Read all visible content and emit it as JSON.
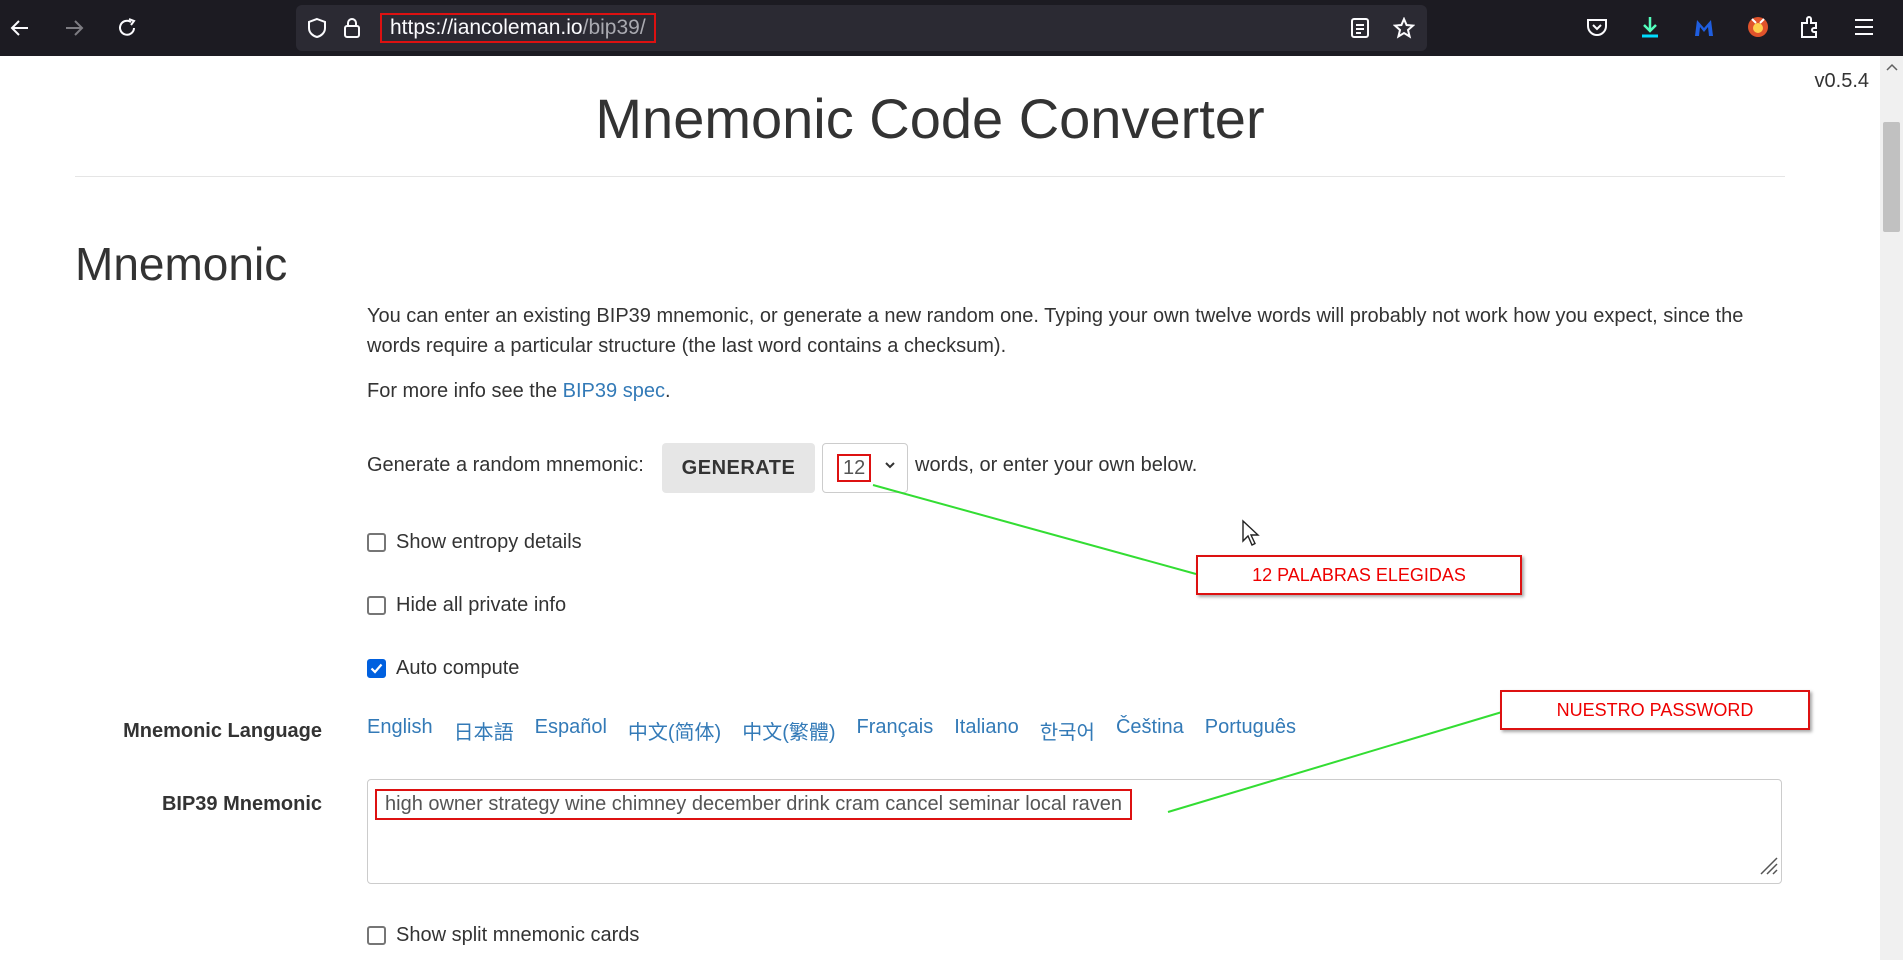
{
  "browser": {
    "url_host": "https://iancoleman.io",
    "url_path": "/bip39/",
    "icons": [
      "back-arrow-icon",
      "forward-arrow-icon",
      "reload-icon",
      "shield-icon",
      "lock-icon",
      "reader-view-icon",
      "bookmark-star-icon",
      "pocket-icon",
      "download-icon",
      "malwarebytes-icon",
      "extension-fox-icon",
      "extensions-icon",
      "menu-icon"
    ]
  },
  "page": {
    "version": "v0.5.4",
    "title": "Mnemonic Code Converter",
    "section_title": "Mnemonic",
    "intro": "You can enter an existing BIP39 mnemonic, or generate a new random one. Typing your own twelve words will probably not work how you expect, since the words require a particular structure (the last word contains a checksum).",
    "more_info_prefix": "For more info see the ",
    "more_info_link": "BIP39 spec",
    "more_info_suffix": "."
  },
  "generate": {
    "label": "Generate a random mnemonic:",
    "button": "GENERATE",
    "word_count": "12",
    "after_label": "words, or enter your own below."
  },
  "options": {
    "show_entropy": "Show entropy details",
    "hide_private": "Hide all private info",
    "auto_compute": "Auto compute",
    "show_split": "Show split mnemonic cards",
    "auto_compute_checked": true
  },
  "language": {
    "label": "Mnemonic Language",
    "items": [
      "English",
      "日本語",
      "Español",
      "中文(简体)",
      "中文(繁體)",
      "Français",
      "Italiano",
      "한국어",
      "Čeština",
      "Português"
    ]
  },
  "mnemonic": {
    "label": "BIP39 Mnemonic",
    "value": "high owner strategy wine chimney december drink cram cancel seminar local raven"
  },
  "annotations": {
    "words_note": "12 PALABRAS ELEGIDAS",
    "password_note": "NUESTRO PASSWORD"
  },
  "colors": {
    "link": "#337ab7",
    "annotation": "#dd1111",
    "annotation_line": "#33dd33",
    "checkbox": "#0060df"
  }
}
